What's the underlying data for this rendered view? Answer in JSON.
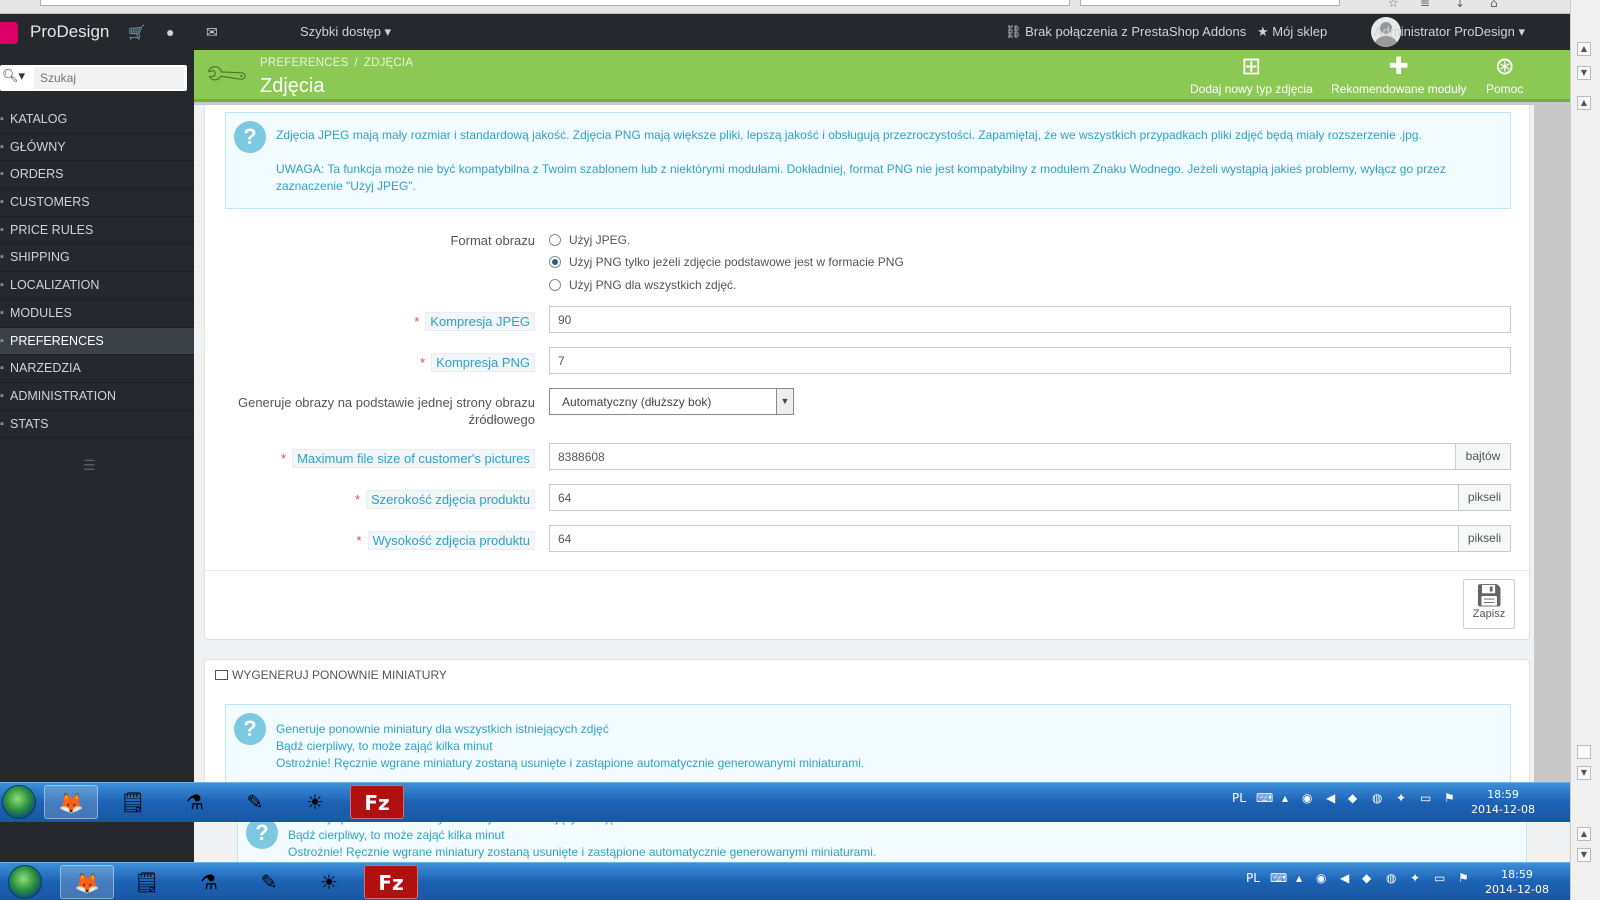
{
  "header": {
    "brand": "ProDesign",
    "quick_access": "Szybki dostęp ▾",
    "addons_status": "Brak połączenia z PrestaShop Addons",
    "my_shop": "Mój sklep",
    "user": "Administrator ProDesign ▾"
  },
  "sidebar": {
    "search_placeholder": "Szukaj",
    "items": [
      {
        "label": "KATALOG"
      },
      {
        "label": "GŁÓWNY"
      },
      {
        "label": "ORDERS"
      },
      {
        "label": "CUSTOMERS"
      },
      {
        "label": "PRICE RULES"
      },
      {
        "label": "SHIPPING"
      },
      {
        "label": "LOCALIZATION"
      },
      {
        "label": "MODULES"
      },
      {
        "label": "PREFERENCES"
      },
      {
        "label": "NARZEDZIA"
      },
      {
        "label": "ADMINISTRATION"
      },
      {
        "label": "STATS"
      }
    ]
  },
  "toolbar": {
    "breadcrumb_1": "PREFERENCES",
    "breadcrumb_sep": "/",
    "breadcrumb_2": "ZDJĘCIA",
    "title": "Zdjęcia",
    "add_type": "Dodaj nowy typ zdjęcia",
    "recommended": "Rekomendowane moduły",
    "help": "Pomoc"
  },
  "info": {
    "line1": "Zdjęcia JPEG mają mały rozmiar i standardową jakość. Zdjęcia PNG mają większe pliki, lepszą jakość i obsługują przezroczystości. Zapamiętaj, że we wszystkich przypadkach pliki zdjęć będą miały rozszerzenie .jpg.",
    "line2": "UWAGA: Ta funkcja może nie być kompatybilna z Twoim szablonem lub z niektórymi modułami. Dokładniej, format PNG nie jest kompatybilny z modułem Znaku Wodnego. Jeżeli wystąpią jakieś problemy, wyłącz go przez zaznaczenie \"Użyj JPEG\"."
  },
  "form": {
    "format_label": "Format obrazu",
    "format_options": [
      {
        "label": "Użyj JPEG.",
        "checked": false
      },
      {
        "label": "Użyj PNG tylko jeżeli zdjęcie podstawowe jest w formacie PNG",
        "checked": true
      },
      {
        "label": "Użyj PNG dla wszystkich zdjęć.",
        "checked": false
      }
    ],
    "jpeg_label": "Kompresja JPEG",
    "jpeg_value": "90",
    "png_label": "Kompresja PNG",
    "png_value": "7",
    "side_label_1": "Generuje obrazy na podstawie jednej strony obrazu",
    "side_label_2": "źródłowego",
    "side_value": "Automatyczny (dłuższy bok)",
    "maxsize_label": "Maximum file size of customer's pictures",
    "maxsize_value": "8388608",
    "maxsize_unit": "bajtów",
    "width_label": "Szerokość zdjęcia produktu",
    "width_value": "64",
    "width_unit": "pikseli",
    "height_label": "Wysokość zdjęcia produktu",
    "height_value": "64",
    "height_unit": "pikseli",
    "save": "Zapisz"
  },
  "regen": {
    "title": "WYGENERUJ PONOWNIE MINIATURY",
    "line1": "Generuje ponownie miniatury dla wszystkich istniejących zdjęć",
    "line2": "Bądź cierpliwy, to może zająć kilka minut",
    "line3": "Ostrożnie! Ręcznie wgrane miniatury zostaną usunięte i zastąpione automatycznie generowanymi miniaturami."
  },
  "taskbar": {
    "lang": "PL",
    "time": "18:59",
    "date": "2014-12-08"
  }
}
